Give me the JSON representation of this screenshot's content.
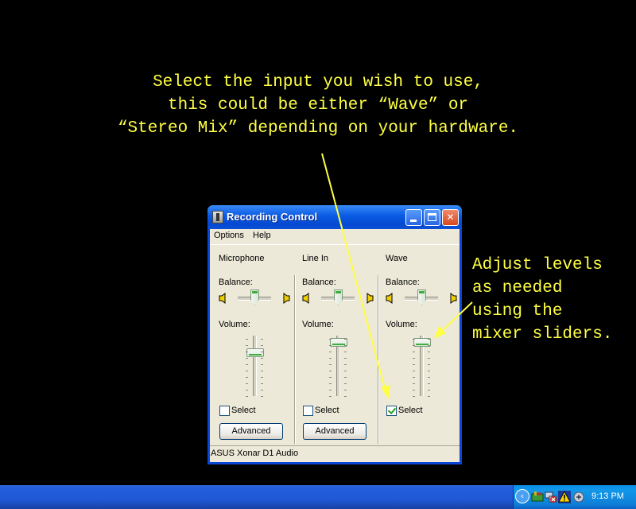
{
  "annotations": {
    "top": "Select the input you wish to use,\nthis could be either “Wave” or\n“Stereo Mix” depending on your hardware.",
    "right": "Adjust levels\nas needed\nusing the\nmixer sliders."
  },
  "window": {
    "title": "Recording Control",
    "menu": [
      "Options",
      "Help"
    ],
    "status": "ASUS Xonar D1 Audio"
  },
  "channels": [
    {
      "name": "Microphone",
      "balance_label": "Balance:",
      "volume_label": "Volume:",
      "select_label": "Select",
      "selected": false,
      "advanced_label": "Advanced",
      "balance": 0.5,
      "volume": 0.75
    },
    {
      "name": "Line In",
      "balance_label": "Balance:",
      "volume_label": "Volume:",
      "select_label": "Select",
      "selected": false,
      "advanced_label": "Advanced",
      "balance": 0.5,
      "volume": 0.95
    },
    {
      "name": "Wave",
      "balance_label": "Balance:",
      "volume_label": "Volume:",
      "select_label": "Select",
      "selected": true,
      "balance": 0.5,
      "volume": 0.95
    }
  ],
  "taskbar": {
    "clock": "9:13 PM",
    "tray_icons": [
      "volume-icon",
      "network-error-icon",
      "security-warning-icon",
      "mixer-icon"
    ]
  },
  "colors": {
    "annotation": "#ffff44",
    "titlebar": "#0a5ae4",
    "window_bg": "#ece9d8"
  }
}
